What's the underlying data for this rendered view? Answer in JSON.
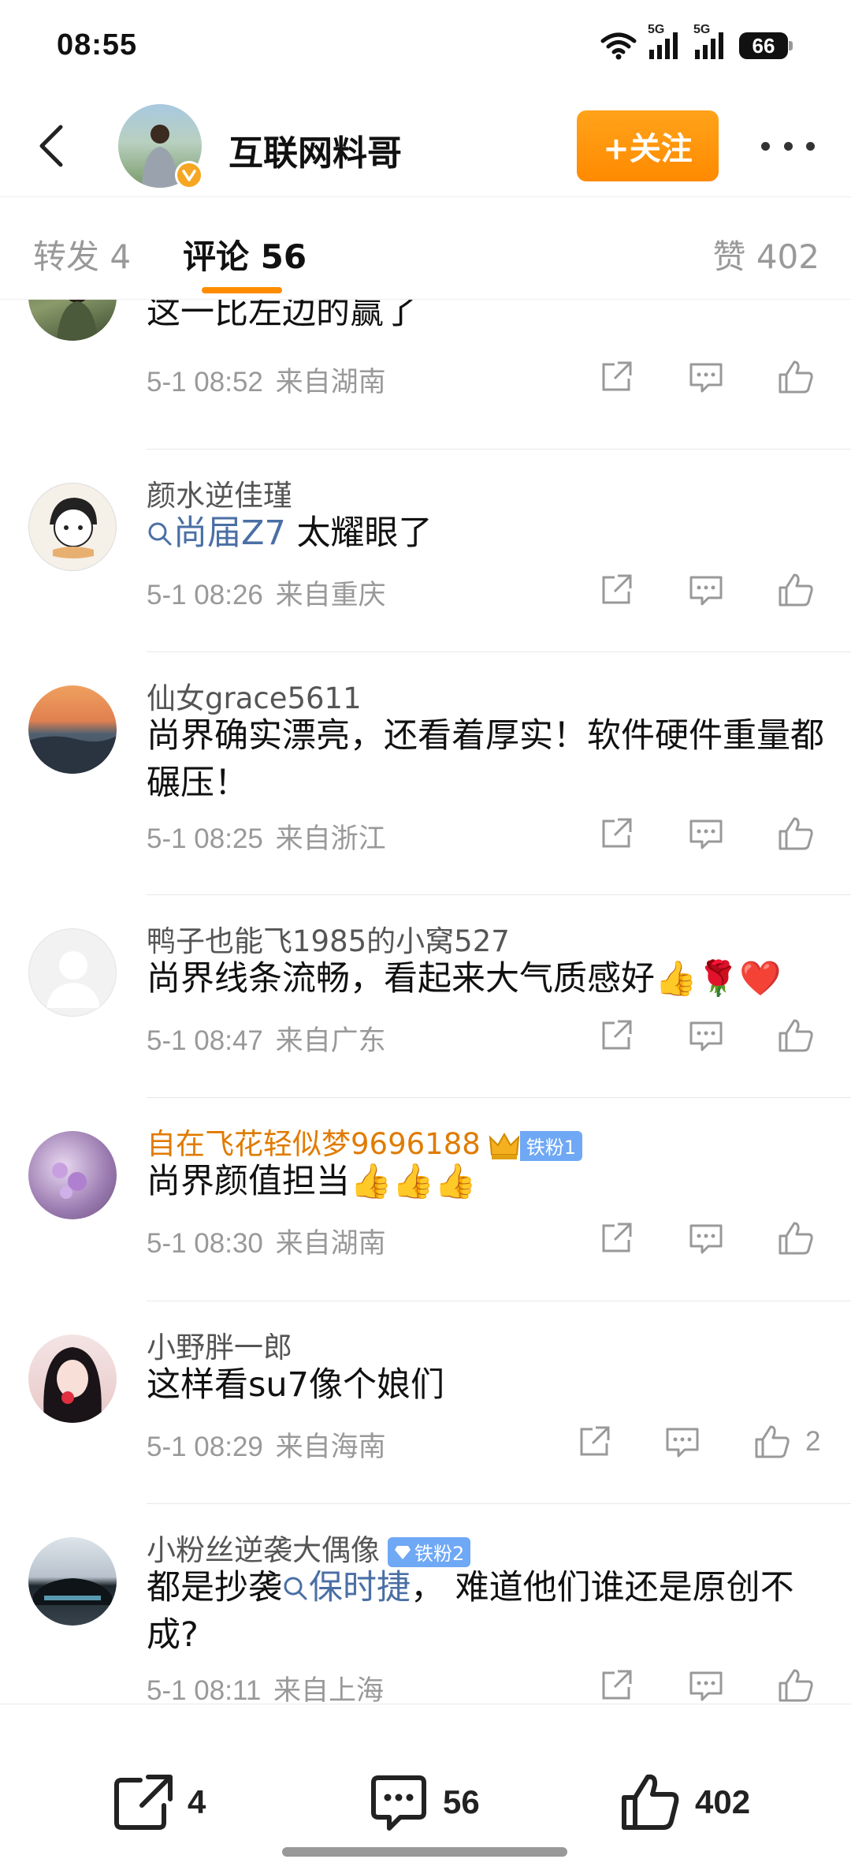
{
  "status": {
    "time": "08:55",
    "network1": "5G",
    "network2": "5G",
    "battery": "66"
  },
  "header": {
    "name": "互联网料哥",
    "follow_label": "+关注"
  },
  "tabs": {
    "repost": "转发 4",
    "comment": "评论 56",
    "like": "赞 402"
  },
  "comments": [
    {
      "name": "",
      "text": "这一比左边的赢了",
      "time": "5-1 08:52",
      "location": "来自湖南"
    },
    {
      "name": "颜水逆佳瑾",
      "topic": "尚届Z7",
      "text": " 太耀眼了",
      "time": "5-1 08:26",
      "location": "来自重庆"
    },
    {
      "name": "仙女grace5611",
      "text": "尚界确实漂亮，还看着厚实！软件硬件重量都碾压！",
      "time": "5-1 08:25",
      "location": "来自浙江"
    },
    {
      "name": "鸭子也能飞1985的小窝527",
      "text": "尚界线条流畅，看起来大气质感好👍🌹❤️",
      "time": "5-1 08:47",
      "location": "来自广东"
    },
    {
      "name": "自在飞花轻似梦9696188",
      "badge": "铁粉1",
      "text": "尚界颜值担当👍👍👍",
      "time": "5-1 08:30",
      "location": "来自湖南"
    },
    {
      "name": "小野胖一郎",
      "text": "这样看su7像个娘们",
      "time": "5-1 08:29",
      "location": "来自海南",
      "likes": "2"
    },
    {
      "name": "小粉丝逆袭大偶像",
      "badge": "铁粉2",
      "text_before": "都是抄袭",
      "topic": "保时捷",
      "text_after": "， 难道他们谁还是原创不成?",
      "time": "5-1 08:11",
      "location": "来自上海"
    }
  ],
  "bottom": {
    "reposts": "4",
    "comments": "56",
    "likes": "402"
  },
  "colors": {
    "accent": "#ff8c00",
    "topic": "#4a6fa5",
    "vip_name": "#e07b00",
    "badge": "#6fa8f5"
  }
}
